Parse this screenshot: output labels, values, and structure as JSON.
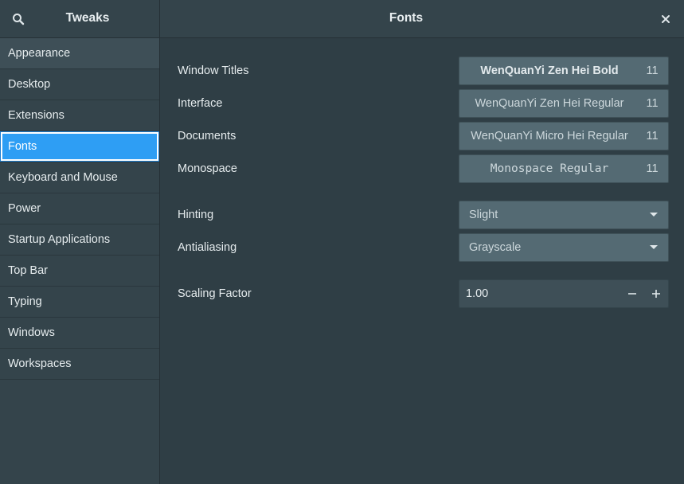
{
  "header": {
    "app_title": "Tweaks",
    "page_title": "Fonts",
    "search_icon": "search-icon",
    "close_icon": "close-icon"
  },
  "sidebar": {
    "items": [
      {
        "label": "Appearance"
      },
      {
        "label": "Desktop"
      },
      {
        "label": "Extensions"
      },
      {
        "label": "Fonts"
      },
      {
        "label": "Keyboard and Mouse"
      },
      {
        "label": "Power"
      },
      {
        "label": "Startup Applications"
      },
      {
        "label": "Top Bar"
      },
      {
        "label": "Typing"
      },
      {
        "label": "Windows"
      },
      {
        "label": "Workspaces"
      }
    ],
    "selected": "Fonts"
  },
  "fonts": {
    "window_titles": {
      "label": "Window Titles",
      "font": "WenQuanYi Zen Hei Bold",
      "size": "11"
    },
    "interface": {
      "label": "Interface",
      "font": "WenQuanYi Zen Hei Regular",
      "size": "11"
    },
    "documents": {
      "label": "Documents",
      "font": "WenQuanYi Micro Hei Regular",
      "size": "11"
    },
    "monospace": {
      "label": "Monospace",
      "font": "Monospace Regular",
      "size": "11"
    }
  },
  "rendering": {
    "hinting": {
      "label": "Hinting",
      "value": "Slight"
    },
    "antialiasing": {
      "label": "Antialiasing",
      "value": "Grayscale"
    }
  },
  "scaling": {
    "label": "Scaling Factor",
    "value": "1.00"
  },
  "colors": {
    "accent": "#2e9ef4",
    "background": "#2f3e45",
    "sidebar": "#34444b",
    "button": "#546a73"
  }
}
